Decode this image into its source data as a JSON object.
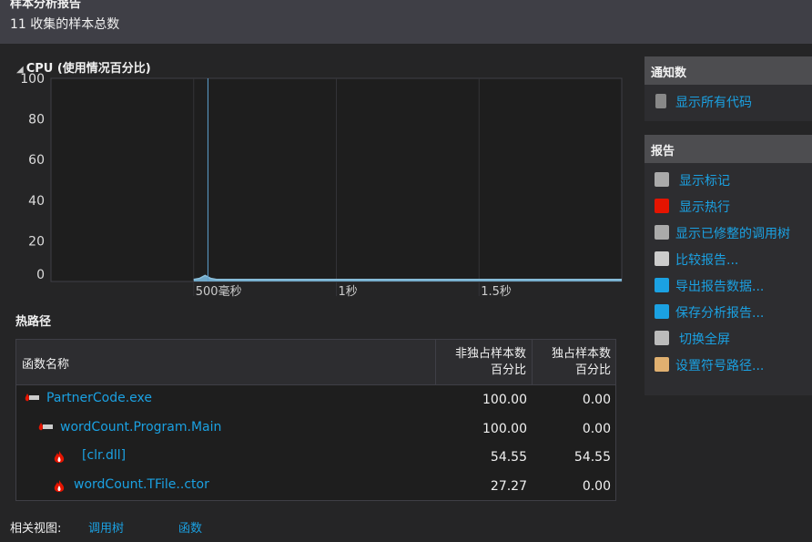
{
  "header": {
    "title": "样本分析报告",
    "subtitle": "11 收集的样本总数"
  },
  "cpu": {
    "title": "CPU (使用情况百分比)"
  },
  "chart_data": {
    "type": "line",
    "title": "CPU (使用情况百分比)",
    "xlabel": "",
    "ylabel": "",
    "xlim": [
      0,
      2
    ],
    "ylim": [
      0,
      100
    ],
    "y_ticks": [
      {
        "v": 0,
        "label": "0"
      },
      {
        "v": 20,
        "label": "20"
      },
      {
        "v": 40,
        "label": "40"
      },
      {
        "v": 60,
        "label": "60"
      },
      {
        "v": 80,
        "label": "80"
      },
      {
        "v": 100,
        "label": "100"
      }
    ],
    "x_ticks": [
      {
        "v": 0.5,
        "label": "500毫秒"
      },
      {
        "v": 1,
        "label": "1秒"
      },
      {
        "v": 1.5,
        "label": "1.5秒"
      }
    ],
    "series": [
      {
        "name": "CPU",
        "x": [
          0.5,
          0.52,
          0.54,
          0.56,
          0.58,
          1.0,
          1.5,
          2.0
        ],
        "y": [
          1,
          1.5,
          3,
          1.5,
          1,
          1,
          1,
          1
        ]
      }
    ],
    "selection_x": 0.55,
    "grid": true
  },
  "hotpath": {
    "title": "热路径",
    "columns": [
      "函数名称",
      "非独占样本数\n百分比",
      "独占样本数\n百分比"
    ],
    "col1a": "非独占样本数",
    "col1b": "百分比",
    "col2a": "独占样本数",
    "col2b": "百分比",
    "rows": [
      {
        "name": "PartnerCode.exe",
        "inclusive": "100.00",
        "exclusive": "0.00",
        "icon": "hot-path-icon"
      },
      {
        "name": "wordCount.Program.Main",
        "inclusive": "100.00",
        "exclusive": "0.00",
        "icon": "hot-path-icon"
      },
      {
        "name": "[clr.dll]",
        "inclusive": "54.55",
        "exclusive": "54.55",
        "icon": "flame-icon"
      },
      {
        "name": "wordCount.TFile..ctor",
        "inclusive": "27.27",
        "exclusive": "0.00",
        "icon": "flame-icon"
      }
    ]
  },
  "related": {
    "label": "相关视图:",
    "links": [
      "调用树",
      "函数"
    ]
  },
  "notifications": {
    "title": "通知数",
    "items": [
      "显示所有代码"
    ]
  },
  "report": {
    "title": "报告",
    "items": [
      "显示标记",
      "显示热行",
      "显示已修整的调用树",
      "比较报告...",
      "导出报告数据...",
      "保存分析报告...",
      "切换全屏",
      "设置符号路径..."
    ]
  }
}
